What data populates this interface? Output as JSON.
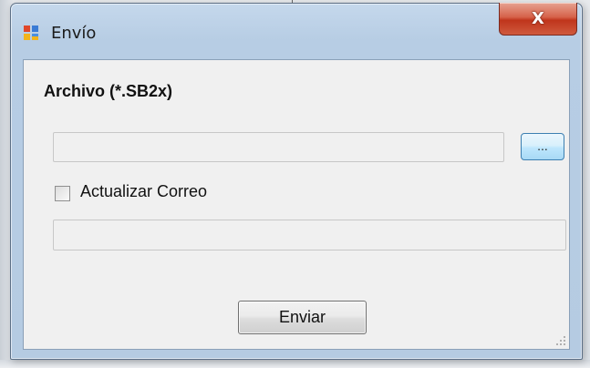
{
  "window": {
    "title": "Envío",
    "icon": "winforms-app-icon",
    "close_glyph": "X"
  },
  "form": {
    "file_label": "Archivo (*.SB2x)",
    "file_value": "",
    "browse_label": "...",
    "update_email_label": "Actualizar Correo",
    "update_email_checked": false,
    "email_value": "",
    "send_label": "Enviar"
  },
  "colors": {
    "close_button": "#c9472c",
    "window_frame": "#b9cfe6",
    "client_bg": "#f0f0f0",
    "browse_button": "#bee6fd"
  }
}
